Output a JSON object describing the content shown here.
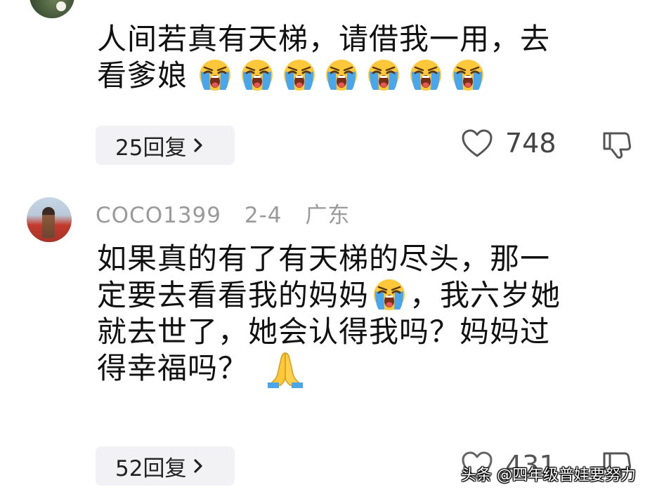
{
  "comments": [
    {
      "lines": [
        "人间若真有天梯，请借我一用，去",
        "看爹娘"
      ],
      "emoji": "loudly-crying-face",
      "emoji_count": 7,
      "reply_label": "25回复",
      "likes": "748"
    },
    {
      "author": "COCO1399",
      "date": "2-4",
      "location": "广东",
      "lines": [
        "如果真的有了有天梯的尽头，那一",
        "定要去看看我的妈妈",
        "，我六岁她",
        "就去世了，她会认得我吗？妈妈过",
        "得幸福吗？"
      ],
      "reply_label": "52回复",
      "likes": "431"
    }
  ],
  "icons": {
    "reply_chevron": "chevron-right-icon",
    "like": "heart-outline-icon",
    "dislike": "thumbs-down-icon",
    "crying": "loudly-crying-face",
    "pray": "folded-hands"
  },
  "watermark": "头条 @四年级普娃要努力"
}
